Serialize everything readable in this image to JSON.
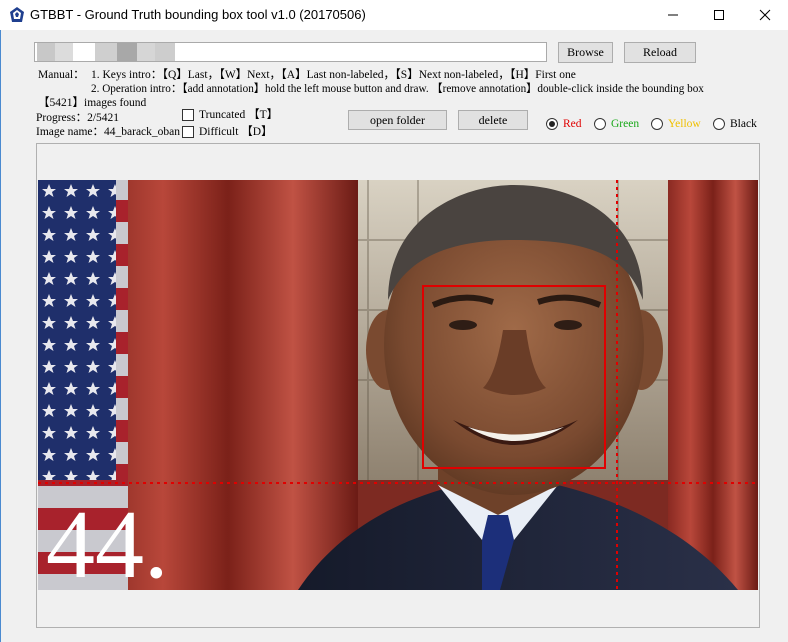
{
  "window": {
    "title": "GTBBT - Ground Truth bounding box tool v1.0 (20170506)"
  },
  "toolbar": {
    "browse_label": "Browse",
    "reload_label": "Reload",
    "open_folder_label": "open folder",
    "delete_label": "delete"
  },
  "manual": {
    "label": "Manual：",
    "keys_intro": "1. Keys intro：【Q】Last，【W】Next，【A】Last non-labeled，【S】Next non-labeled，【H】First one",
    "operation_intro": "2. Operation intro：【add annotation】hold the left mouse button and draw. 【remove annotation】double-click inside the bounding box"
  },
  "status": {
    "images_found": "【5421】images found",
    "progress": "Progress：2/5421",
    "image_name": "Image name：44_barack_oban"
  },
  "flags": {
    "truncated_label": "Truncated 【T】",
    "difficult_label": "Difficult 【D】"
  },
  "colors": {
    "options": [
      {
        "label": "Red",
        "color": "#e00000",
        "checked": true
      },
      {
        "label": "Green",
        "color": "#19a819",
        "checked": false
      },
      {
        "label": "Yellow",
        "color": "#f0c000",
        "checked": false
      },
      {
        "label": "Black",
        "color": "#000000",
        "checked": false
      }
    ]
  },
  "image": {
    "overlay_text": "44."
  }
}
